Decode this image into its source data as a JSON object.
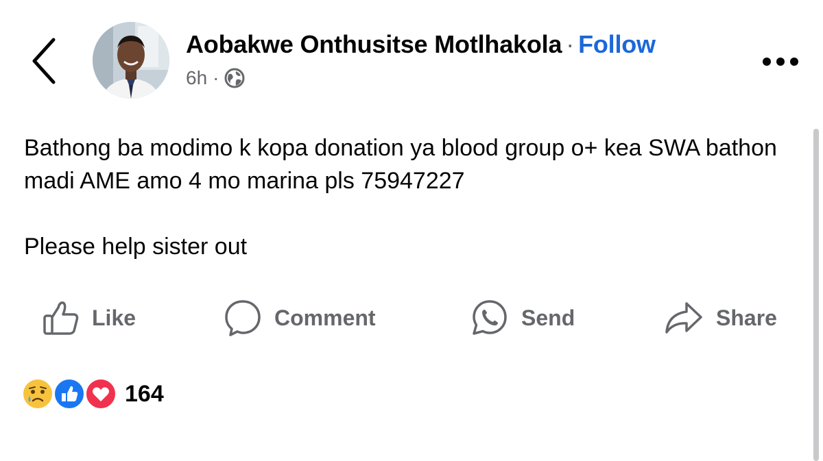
{
  "author": {
    "name": "Aobakwe Onthusitse Motlhakola",
    "separator": "·",
    "follow_label": "Follow"
  },
  "meta": {
    "time": "6h",
    "separator": "·",
    "audience_icon": "globe-icon"
  },
  "post": {
    "paragraphs": [
      "Bathong ba modimo k kopa donation ya blood group o+ kea SWA bathon madi AME amo 4 mo marina pls 75947227",
      "Please help sister out"
    ]
  },
  "actions": [
    {
      "label": "Like",
      "icon": "thumbs-up-icon"
    },
    {
      "label": "Comment",
      "icon": "comment-bubble-icon"
    },
    {
      "label": "Send",
      "icon": "whatsapp-icon"
    },
    {
      "label": "Share",
      "icon": "share-arrow-icon"
    }
  ],
  "reactions": {
    "icons": [
      "sad-reaction-icon",
      "like-reaction-icon",
      "love-reaction-icon"
    ],
    "count": "164"
  },
  "colors": {
    "follow": "#1b68d8",
    "secondary_text": "#65676b",
    "like_blue": "#1a77f2",
    "love_red": "#f0324e",
    "sad_yellow": "#f7c33d"
  }
}
